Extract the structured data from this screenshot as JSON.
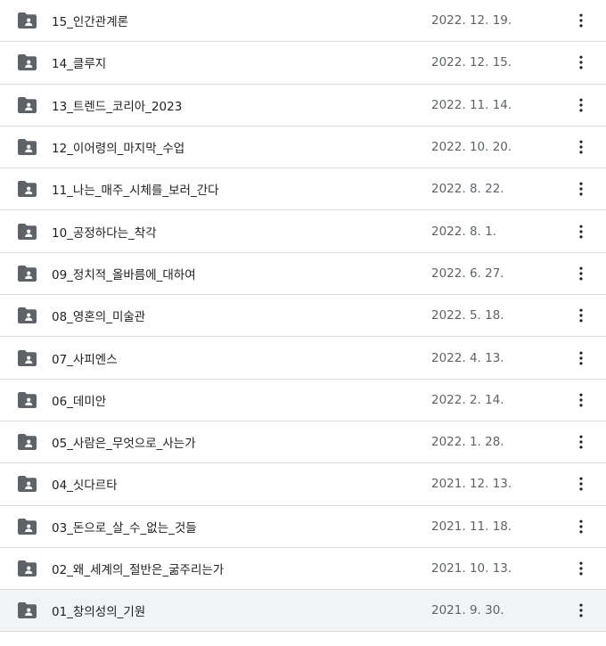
{
  "colors": {
    "folder_icon": "#5f6368",
    "text_primary": "#202124",
    "text_secondary": "#5f6368",
    "divider": "#dadce0",
    "selected_row_bg": "#f1f3f4"
  },
  "icons": {
    "row_icon": "shared-folder-icon",
    "menu_icon": "more-vert-icon"
  },
  "files": [
    {
      "name": "15_인간관계론",
      "date": "2022. 12. 19."
    },
    {
      "name": "14_클루지",
      "date": "2022. 12. 15."
    },
    {
      "name": "13_트렌드_코리아_2023",
      "date": "2022. 11. 14."
    },
    {
      "name": "12_이어령의_마지막_수업",
      "date": "2022. 10. 20."
    },
    {
      "name": "11_나는_매주_시체를_보러_간다",
      "date": "2022. 8. 22."
    },
    {
      "name": "10_공정하다는_착각",
      "date": "2022. 8. 1."
    },
    {
      "name": "09_정치적_올바름에_대하여",
      "date": "2022. 6. 27."
    },
    {
      "name": "08_영혼의_미술관",
      "date": "2022. 5. 18."
    },
    {
      "name": "07_사피엔스",
      "date": "2022. 4. 13."
    },
    {
      "name": "06_데미안",
      "date": "2022. 2. 14."
    },
    {
      "name": "05_사람은_무엇으로_사는가",
      "date": "2022. 1. 28."
    },
    {
      "name": "04_싯다르타",
      "date": "2021. 12. 13."
    },
    {
      "name": "03_돈으로_살_수_없는_것들",
      "date": "2021. 11. 18."
    },
    {
      "name": "02_왜_세계의_절반은_굶주리는가",
      "date": "2021. 10. 13."
    },
    {
      "name": "01_창의성의_기원",
      "date": "2021. 9. 30.",
      "selected": true
    }
  ]
}
